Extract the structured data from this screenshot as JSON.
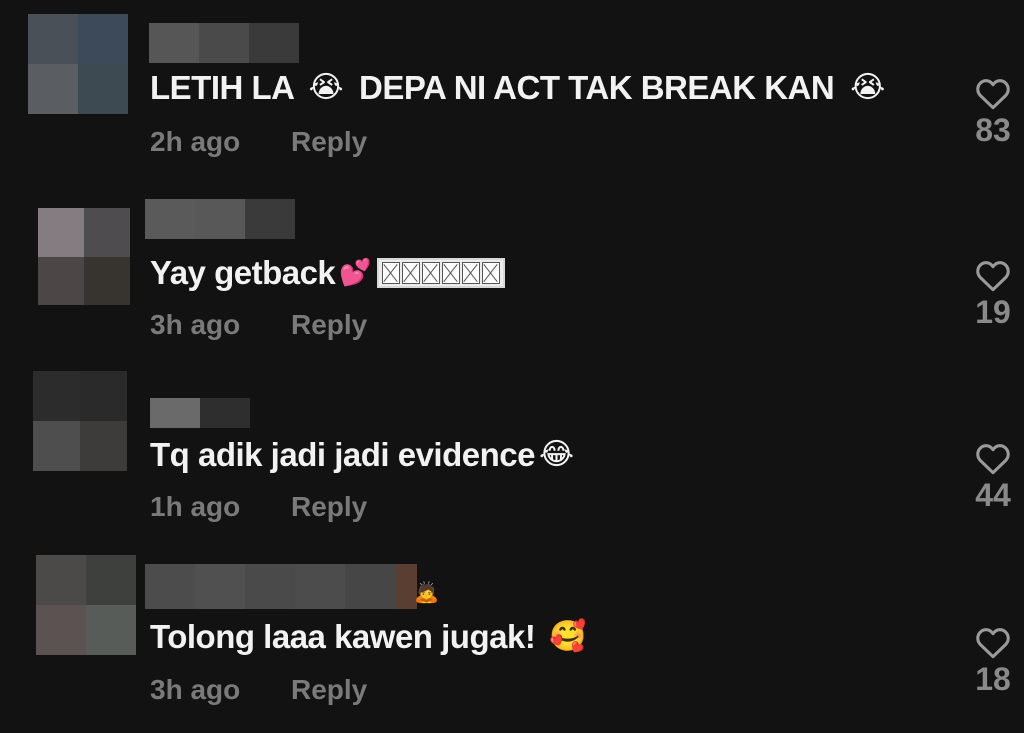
{
  "comments": [
    {
      "text": "LETIH LA",
      "emoji1": "😭",
      "text2": "DEPA NI ACT TAK BREAK KAN",
      "emoji2": "😭",
      "time": "2h ago",
      "reply_label": "Reply",
      "likes": "83",
      "avatar_colors": [
        "#4a5058",
        "#3c4a5a",
        "#5a5e62",
        "#3e4a52"
      ],
      "username_colors": [
        "#565656",
        "#4a4a4a",
        "#3a3a3a"
      ]
    },
    {
      "text": "Yay getback",
      "emoji1": "💕",
      "time": "3h ago",
      "reply_label": "Reply",
      "likes": "19",
      "avatar_colors": [
        "#847c80",
        "#4e4c4e",
        "#4c4746",
        "#37342f"
      ],
      "username_colors": [
        "#5a5a5a",
        "#585858",
        "#3a3a3a"
      ]
    },
    {
      "text": "Tq adik jadi jadi evidence",
      "emoji1": "😂",
      "time": "1h ago",
      "reply_label": "Reply",
      "likes": "44",
      "avatar_colors": [
        "#2c2c2c",
        "#2a2a2a",
        "#4e4e4e",
        "#3e3c3a"
      ],
      "username_colors": [
        "#6a6a6a",
        "#2e2e2e"
      ]
    },
    {
      "text": "Tolong laaa kawen jugak!",
      "emoji1": "🥰",
      "time": "3h ago",
      "reply_label": "Reply",
      "likes": "18",
      "avatar_colors": [
        "#4b4a48",
        "#3e403e",
        "#5c5252",
        "#585c58"
      ],
      "username_colors": [
        "#4c4c4c",
        "#505050",
        "#4a4a4a",
        "#4c4c4c",
        "#464646",
        "#5a3e32"
      ]
    }
  ]
}
